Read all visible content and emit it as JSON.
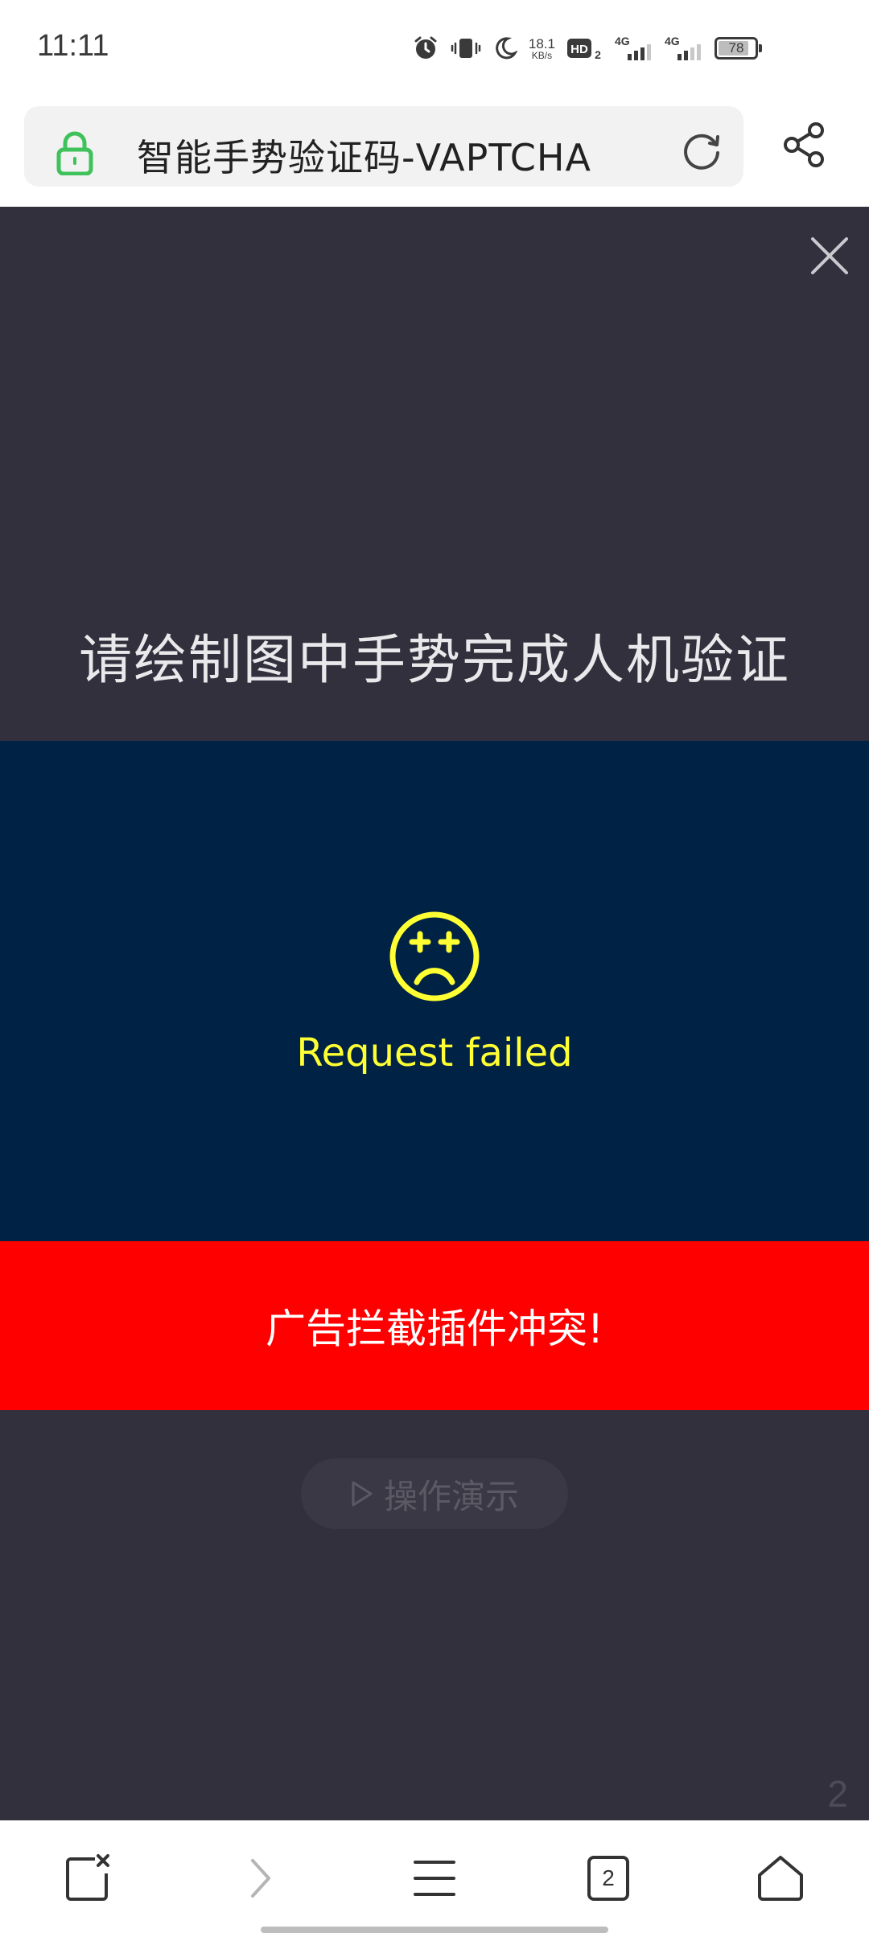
{
  "status_bar": {
    "time": "11:11",
    "net_speed_value": "18.1",
    "net_speed_unit": "KB/s",
    "hd_label": "HD",
    "hd_sub": "2",
    "network_1": "4G",
    "network_2": "4G",
    "battery_level": 78,
    "battery_label": "78",
    "icons": [
      "alarm-icon",
      "vibrate-icon",
      "moon-icon"
    ]
  },
  "address_bar": {
    "title": "智能手势验证码-VAPTCHA",
    "lock_color": "#3fc25a"
  },
  "captcha": {
    "instruction": "请绘制图中手势完成人机验证",
    "error_message": "Request failed",
    "error_color": "#ffff33",
    "alert_message": "广告拦截插件冲突!",
    "alert_color": "#ff0000",
    "demo_button_label": "操作演示",
    "page_number": "2"
  },
  "bottom_nav": {
    "tab_count": "2"
  }
}
